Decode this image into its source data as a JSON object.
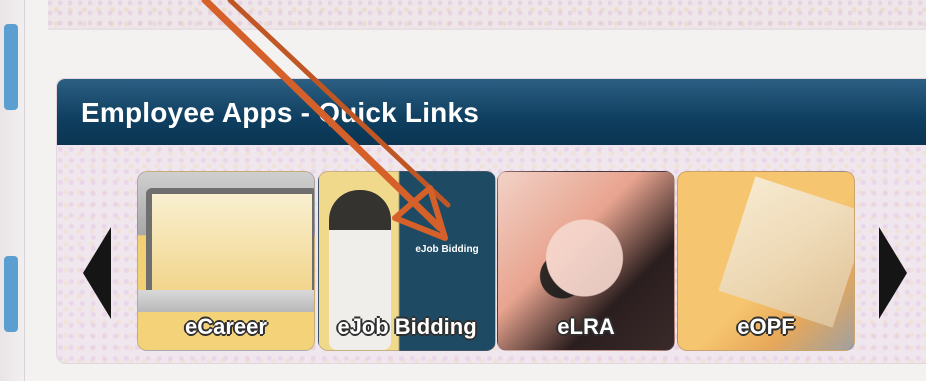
{
  "widget": {
    "title": "Employee Apps - Quick Links"
  },
  "tiles": [
    {
      "label": "eCareer"
    },
    {
      "label": "eJob Bidding",
      "screen_text": "eJob Bidding"
    },
    {
      "label": "eLRA"
    },
    {
      "label": "eOPF"
    }
  ],
  "carousel": {
    "prev_icon": "triangle-left-icon",
    "next_icon": "triangle-right-icon"
  },
  "colors": {
    "header_dark": "#0f3f60",
    "annotation_arrow": "#d6602a",
    "gutter_tab": "#5b9fd1"
  }
}
